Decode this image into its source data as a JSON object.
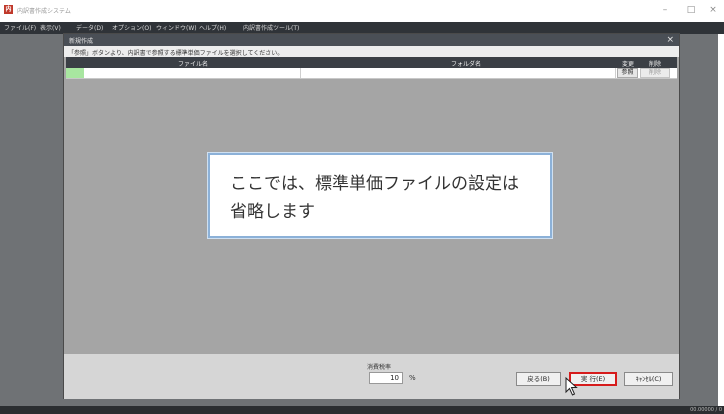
{
  "app": {
    "title": "内訳書作成システム",
    "icon_letter": "内",
    "minimize": "–",
    "maximize": "□",
    "close": "×"
  },
  "menu": [
    "ファイル(F)",
    "表示(V)",
    "データ(D)",
    "オプション(O)",
    "ウィンドウ(W)",
    "ヘルプ(H)",
    "内訳書作成ツール(T)"
  ],
  "dialog": {
    "title": "新規作成",
    "close": "×",
    "instruction": "「参照」ボタンより、内訳書で参照する標準単価ファイルを選択してください。",
    "columns": {
      "file": "ファイル名",
      "folder": "フォルダ名",
      "change": "変更",
      "delete": "削除"
    },
    "row": {
      "ref_button": "参照",
      "del_button": "削除"
    },
    "tax": {
      "label": "消費税率",
      "value": "10",
      "unit": "%"
    },
    "buttons": {
      "back": "戻る(B)",
      "execute": "実 行(E)",
      "cancel": "ｷｬﾝｾﾙ(C)"
    }
  },
  "callout": {
    "line1": "ここでは、標準単価ファイルの設定は",
    "line2": "省略します"
  },
  "status": {
    "text": "00.00000 / 0"
  },
  "colors": {
    "highlight": "#d61c1c",
    "row_marker": "#a8e6a0",
    "callout_border": "#8cb1d8"
  }
}
